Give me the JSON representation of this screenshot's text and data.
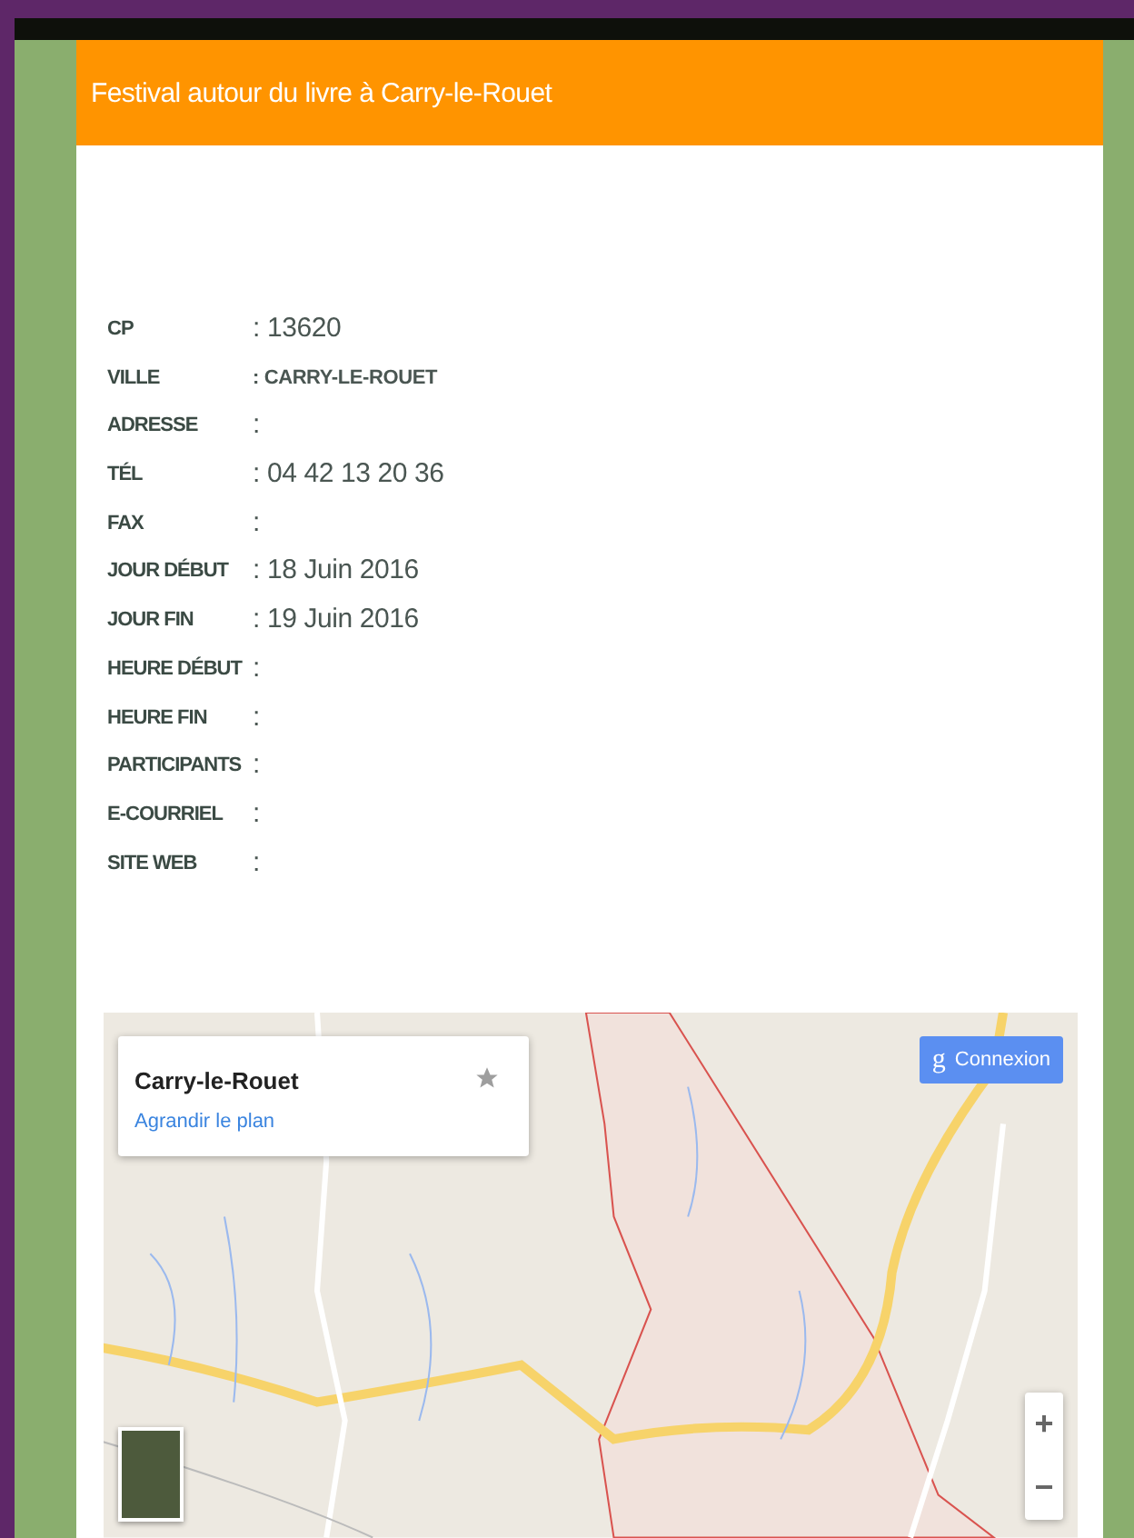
{
  "header": {
    "title": "Festival autour du livre à Carry-le-Rouet"
  },
  "details": [
    {
      "label": "CP",
      "value": "13620",
      "kind": "plain"
    },
    {
      "label": "VILLE",
      "value": "CARRY-LE-ROUET",
      "kind": "small"
    },
    {
      "label": "ADRESSE",
      "kind": "plain"
    },
    {
      "label": "TÉL",
      "value": "04 42 13 20 36",
      "kind": "plain"
    },
    {
      "label": "FAX",
      "kind": "plain"
    },
    {
      "label": "JOUR DÉBUT",
      "value": "18 Juin 2016",
      "kind": "plain"
    },
    {
      "label": "JOUR FIN",
      "value": "19 Juin 2016",
      "kind": "plain"
    },
    {
      "label": "HEURE DÉBUT",
      "kind": "plain"
    },
    {
      "label": "HEURE FIN",
      "kind": "plain"
    },
    {
      "label": "PARTICIPANTS",
      "kind": "plain"
    },
    {
      "label": "E-COURRIEL",
      "kind": "plain"
    },
    {
      "label": "SITE WEB",
      "kind": "plain"
    }
  ],
  "separator": ":",
  "map": {
    "place": "Carry-le-Rouet",
    "link": "Agrandir le plan",
    "login": "Connexion",
    "login_glyph": "g",
    "zoom_in": "+",
    "zoom_out": "−"
  }
}
